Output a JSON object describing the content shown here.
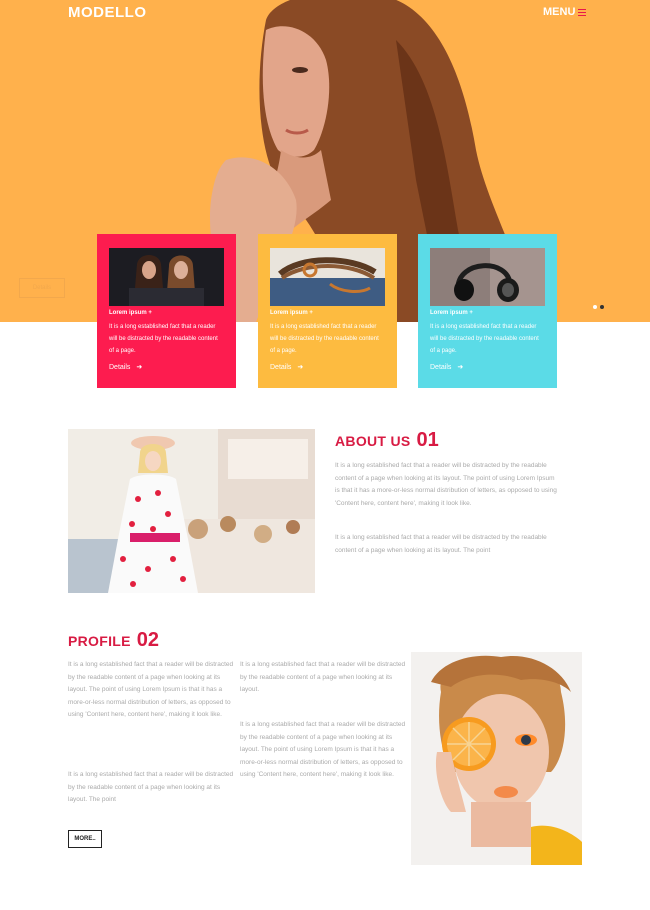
{
  "header": {
    "logo": "MODELLO",
    "menu_label": "MENU"
  },
  "hero": {
    "button_label": "Details",
    "slider": {
      "count": 2,
      "active_index": 1
    }
  },
  "cards": [
    {
      "title": "Lorem ipsum +",
      "text": "It is a long established fact that a reader will be distracted by the readable content of a page.",
      "link": "Details",
      "color": "#fd1c4f"
    },
    {
      "title": "Lorem ipsum +",
      "text": "It is a long established fact that a reader will be distracted by the readable content of a page.",
      "link": "Details",
      "color": "#fdbb40"
    },
    {
      "title": "Lorem ipsum +",
      "text": "It is a long established fact that a reader will be distracted by the readable content of a page.",
      "link": "Details",
      "color": "#5bdbe7"
    }
  ],
  "about": {
    "title": "ABOUT US",
    "number": "01",
    "paragraph1": "It is a long established fact that a reader will be distracted by the readable content of a page when looking at its layout. The point of using Lorem Ipsum is that it has a more-or-less normal distribution of letters, as opposed to using 'Content here, content here', making it look like.",
    "paragraph2": "It is a long established fact that a reader will be distracted by the readable content of a page when looking at its layout. The point"
  },
  "profile": {
    "title": "PROFILE",
    "number": "02",
    "col1_p1": "It is a long established fact that a reader will be distracted by the readable content of a page when looking at its layout. The point of using Lorem Ipsum is that it has a more-or-less normal distribution of letters, as opposed to using 'Content here, content here', making it look like.",
    "col1_p2": "It is a long established fact that a reader will be distracted by the readable content of a page when looking at its layout. The point",
    "col2_p1": "It is a long established fact that a reader will be distracted by the readable content of a page when looking at its layout.",
    "col2_p2": "It is a long established fact that a reader will be distracted by the readable content of a page when looking at its layout. The point of using Lorem Ipsum is that it has a more-or-less normal distribution of letters, as opposed to using 'Content here, content here', making it look like.",
    "more_label": "MORE.."
  },
  "colors": {
    "hero_bg": "#ffb14c",
    "accent": "#d81b43",
    "pink": "#fd1c4f",
    "yellow": "#fdbb40",
    "cyan": "#5bdbe7"
  }
}
